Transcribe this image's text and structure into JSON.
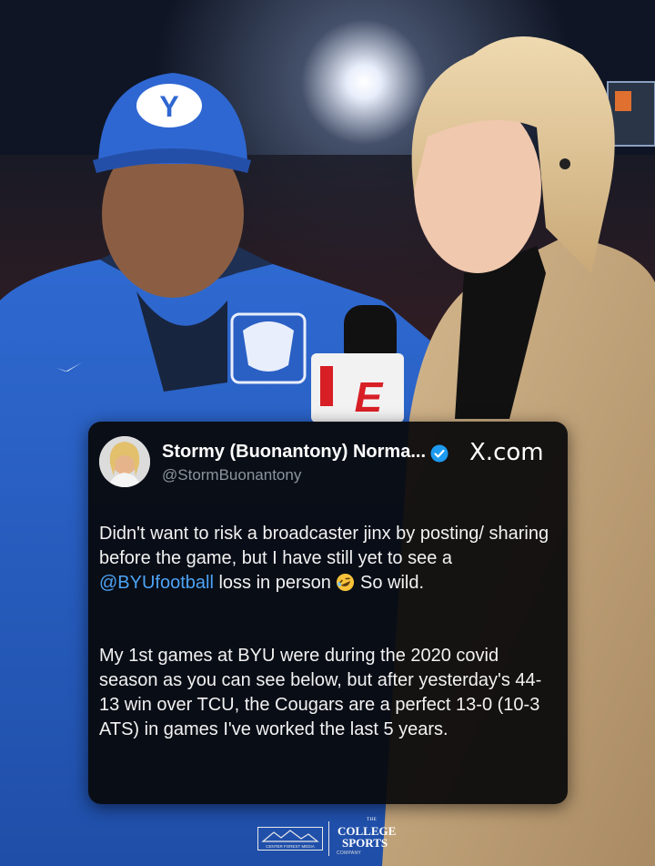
{
  "photo": {
    "description_colors": {
      "cap": "#2a63c9",
      "jacket": "#2a5fc4",
      "coat": "#c9ab82",
      "sky": "#0f1524"
    }
  },
  "tweet": {
    "display_name": "Stormy (Buonantony) Norma...",
    "handle": "@StormBuonantony",
    "site": "X.com",
    "verified": true,
    "paragraph1": {
      "before_mention": "Didn't want to risk a broadcaster jinx by posting/ sharing before the game, but I have still yet to see a ",
      "mention": "@BYUfootball",
      "after_mention": " loss in person ",
      "emoji": "rolling-on-floor-laughing-emoji",
      "tail": " So wild."
    },
    "paragraph2": "My 1st games at BYU were during the 2020 covid season as you can see below, but after yesterday's 44-13 win over TCU, the Cougars are a perfect 13-0 (10-3 ATS) in games I've worked the last 5 years.",
    "accent_color": "#4da3f5"
  },
  "footer": {
    "left_logo_text": "CENTER FOREST MEDIA",
    "right_logo": {
      "the": "THE",
      "college": "COLLEGE",
      "sports": "SPORTS",
      "company": "COMPANY"
    }
  }
}
